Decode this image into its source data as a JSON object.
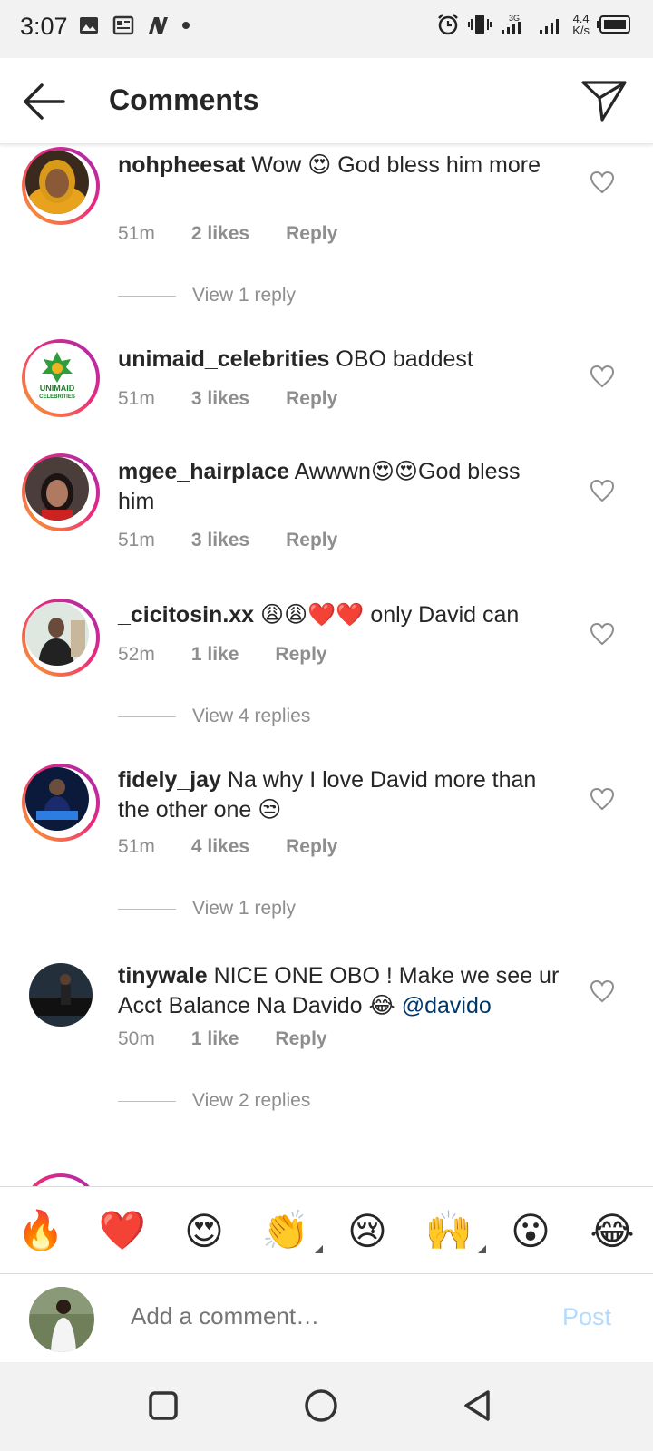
{
  "status_bar": {
    "time": "3:07",
    "speed_value": "4.4",
    "speed_unit": "K/s",
    "net": "3G"
  },
  "header": {
    "title": "Comments",
    "back_icon": "arrow-left-icon",
    "send_icon": "paper-plane-icon"
  },
  "comments": [
    {
      "username": "nohpheesat",
      "text": "Wow 😍 God bless him more",
      "time": "51m",
      "likes": "2 likes",
      "reply": "Reply",
      "view_replies": "View 1 reply"
    },
    {
      "username": "unimaid_celebrities",
      "text": "OBO baddest",
      "time": "51m",
      "likes": "3 likes",
      "reply": "Reply",
      "avatar_line1": "UNIMAID",
      "avatar_line2": "CELEBRITIES"
    },
    {
      "username": "mgee_hairplace",
      "text": "Awwwn😍😍God bless him",
      "time": "51m",
      "likes": "3 likes",
      "reply": "Reply"
    },
    {
      "username": "_cicitosin.xx",
      "text": "😩😩❤️❤️ only David can",
      "time": "52m",
      "likes": "1 like",
      "reply": "Reply",
      "view_replies": "View 4 replies"
    },
    {
      "username": "fidely_jay",
      "text": "Na why I love David more than the other one 😒",
      "time": "51m",
      "likes": "4 likes",
      "reply": "Reply",
      "view_replies": "View 1 reply"
    },
    {
      "username": "tinywale",
      "text": "NICE ONE OBO ! Make we see ur Acct Balance Na Davido 😂",
      "mention": "@davido",
      "time": "50m",
      "likes": "1 like",
      "reply": "Reply",
      "view_replies": "View 2 replies"
    }
  ],
  "emoji_bar": [
    "🔥",
    "❤️",
    "😍",
    "👏",
    "😢",
    "🙌",
    "😮",
    "😂"
  ],
  "add_comment": {
    "placeholder": "Add a comment…",
    "post_label": "Post"
  },
  "colors": {
    "link": "#00376b",
    "meta": "#8e8e8e",
    "post_disabled": "#b3dbff",
    "ring_start": "#f9a825",
    "ring_end": "#9b2bb5"
  }
}
